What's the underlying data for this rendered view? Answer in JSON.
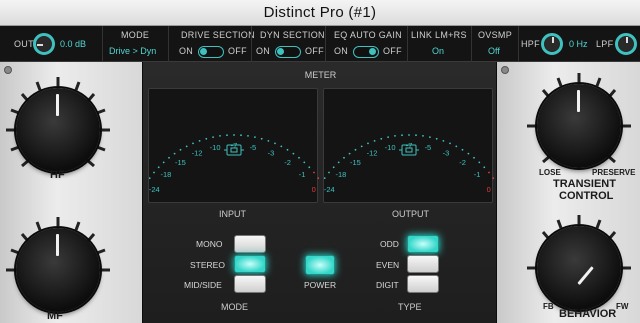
{
  "window": {
    "title": "Distinct Pro (#1)"
  },
  "topbar": {
    "out_label": "OUT",
    "out_value": "0.0 dB",
    "mode_label": "MODE",
    "mode_value": "Drive > Dyn",
    "drive_section": {
      "label": "DRIVE SECTION",
      "on": "ON",
      "off": "OFF"
    },
    "dyn_section": {
      "label": "DYN SECTION",
      "on": "ON",
      "off": "OFF"
    },
    "eq_auto_gain": {
      "label": "EQ AUTO GAIN",
      "on": "ON",
      "off": "OFF"
    },
    "link": {
      "label": "LINK LM+RS",
      "value": "On"
    },
    "ovsmp": {
      "label": "OVSMP",
      "value": "Off"
    },
    "hpf_label": "HPF",
    "hpf_value": "0 Hz",
    "lpf_label": "LPF"
  },
  "left_panel": {
    "hf_label": "HF",
    "mf_label": "MF"
  },
  "right_panel": {
    "lose_label": "LOSE",
    "preserve_label": "PRESERVE",
    "transient_label": "TRANSIENT",
    "control_label": "CONTROL",
    "fb_label": "FB",
    "fw_label": "FW",
    "behavior_label": "BEHAVIOR"
  },
  "meter": {
    "title": "METER",
    "scale": [
      "-24",
      "-18",
      "-15",
      "-12",
      "-10",
      "-7",
      "-5",
      "-3",
      "-2",
      "-1",
      "0"
    ],
    "input_label": "INPUT",
    "output_label": "OUTPUT"
  },
  "mode_switch": {
    "label": "MODE",
    "options": [
      "MONO",
      "STEREO",
      "MID/SIDE"
    ],
    "selected": "STEREO"
  },
  "power": {
    "label": "POWER",
    "on": true
  },
  "type_switch": {
    "label": "TYPE",
    "options": [
      "ODD",
      "EVEN",
      "DIGIT"
    ],
    "selected": "ODD"
  },
  "colors": {
    "accent": "#3fc2bf",
    "value_text": "#4fd6d1",
    "meter_red": "#e23b3b"
  }
}
